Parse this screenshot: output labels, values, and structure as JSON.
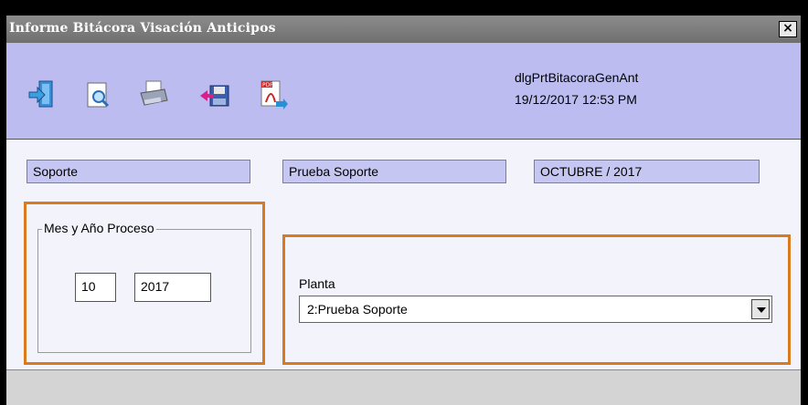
{
  "window": {
    "title": "Informe Bitácora Visación Anticipos",
    "close_label": "×"
  },
  "toolbar": {
    "icons": [
      "exit-icon",
      "preview-icon",
      "print-icon",
      "save-icon",
      "pdf-export-icon"
    ],
    "dialog_name": "dlgPrtBitacoraGenAnt",
    "datetime": "19/12/2017 12:53 PM"
  },
  "header_fields": {
    "user": "Soporte",
    "company": "Prueba Soporte",
    "period": "OCTUBRE / 2017"
  },
  "process": {
    "group_title": "Mes y Año Proceso",
    "month": "10",
    "year": "2017"
  },
  "plant": {
    "label": "Planta",
    "selected": "2:Prueba Soporte"
  },
  "colors": {
    "toolbar_bg": "#bcbcf0",
    "field_bg": "#c6c6f2",
    "highlight": "#d97a1f"
  }
}
